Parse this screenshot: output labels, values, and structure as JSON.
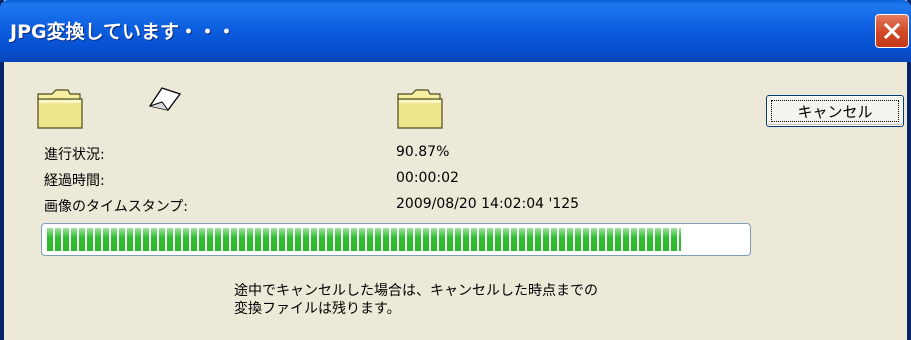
{
  "window": {
    "title": "JPG変換しています・・・",
    "close_icon": "close-icon"
  },
  "icons": {
    "source_folder": "folder-icon",
    "paper": "paper-icon",
    "dest_folder": "folder-icon"
  },
  "status": {
    "progress_label": "進行状況:",
    "progress_value": "90.87%",
    "elapsed_label": "経過時間:",
    "elapsed_value": "00:00:02",
    "timestamp_label": "画像のタイムスタンプ:",
    "timestamp_value": "2009/08/20 14:02:04 '125"
  },
  "buttons": {
    "cancel_label": "キャンセル"
  },
  "progress": {
    "percent": 90.87,
    "bar_color": "#2fc02f"
  },
  "message": {
    "line1": "途中でキャンセルした場合は、キャンセルした時点までの",
    "line2": "変換ファイルは残ります。"
  }
}
